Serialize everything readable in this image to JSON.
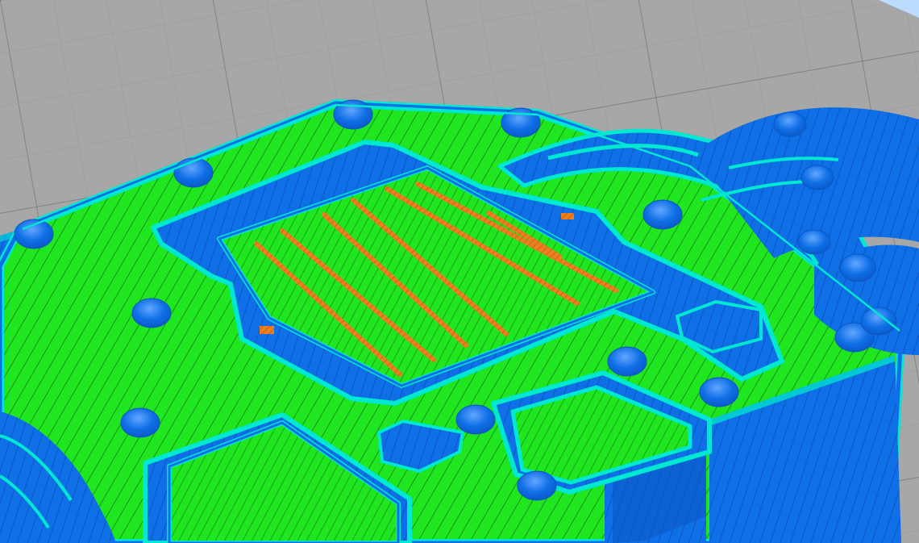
{
  "viewport": {
    "kind": "3d-print-slicer-preview"
  },
  "colors": {
    "build_plate": "#a7a7a7",
    "grid_minor": "#999999",
    "grid_major": "#6f6f6f",
    "wall_outer": "#0f6fe6",
    "wall_dark": "#0b56c3",
    "wall_inner": "#00e7d2",
    "infill": "#20e61f",
    "infill_dark": "#189218",
    "support": "#ef7f1d",
    "support_dark": "#b4581f",
    "sky": "#bcdcff"
  },
  "feature_types": [
    "outer-wall",
    "inner-wall",
    "infill",
    "support",
    "build-plate"
  ]
}
